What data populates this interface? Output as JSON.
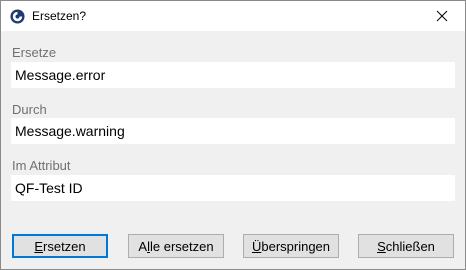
{
  "window": {
    "title": "Ersetzen?",
    "app_icon": "qftest-app-icon",
    "close_icon": "close-icon"
  },
  "fields": [
    {
      "label": "Ersetze",
      "value": "Message.error"
    },
    {
      "label": "Durch",
      "value": "Message.warning"
    },
    {
      "label": "Im Attribut",
      "value": "QF-Test ID"
    }
  ],
  "buttons": [
    {
      "mnemonic": "E",
      "rest": "rsetzen",
      "is_default": true
    },
    {
      "pre": "A",
      "mnemonic": "l",
      "rest": "le ersetzen"
    },
    {
      "mnemonic": "Ü",
      "rest": "berspringen"
    },
    {
      "mnemonic": "S",
      "rest": "chließen"
    }
  ],
  "colors": {
    "default_button_border": "#0078d7",
    "label_gray": "#707070"
  }
}
